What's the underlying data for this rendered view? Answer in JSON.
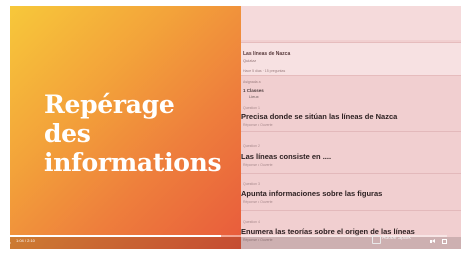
{
  "slide": {
    "title_lines": [
      "Repérage",
      "des",
      "informations"
    ]
  },
  "document": {
    "title": "Las líneas de Nazca",
    "subtitle": "Quizizz",
    "meta": "Hace 5 días · 15 preguntas",
    "section_label": "Asignada a",
    "class_label": "1 Classes",
    "class_name": "Lieux",
    "questions": [
      {
        "num": "Question 1",
        "text": "Precisa donde se sitúan las líneas de Nazca",
        "sub": "Réponse • Ouverte"
      },
      {
        "num": "Question 2",
        "text": "Las líneas consiste en ....",
        "sub": "Réponse • Ouverte"
      },
      {
        "num": "Question 3",
        "text": "Apunta informaciones sobre las figuras",
        "sub": "Réponse • Ouverte"
      },
      {
        "num": "Question 4",
        "text": "Enumera las teorías sobre el origen de las líneas",
        "sub": "Réponse • Ouverte"
      }
    ]
  },
  "player": {
    "time": "1:04 / 2:10",
    "progress": 0.49,
    "brand": "Adobe Spark"
  }
}
